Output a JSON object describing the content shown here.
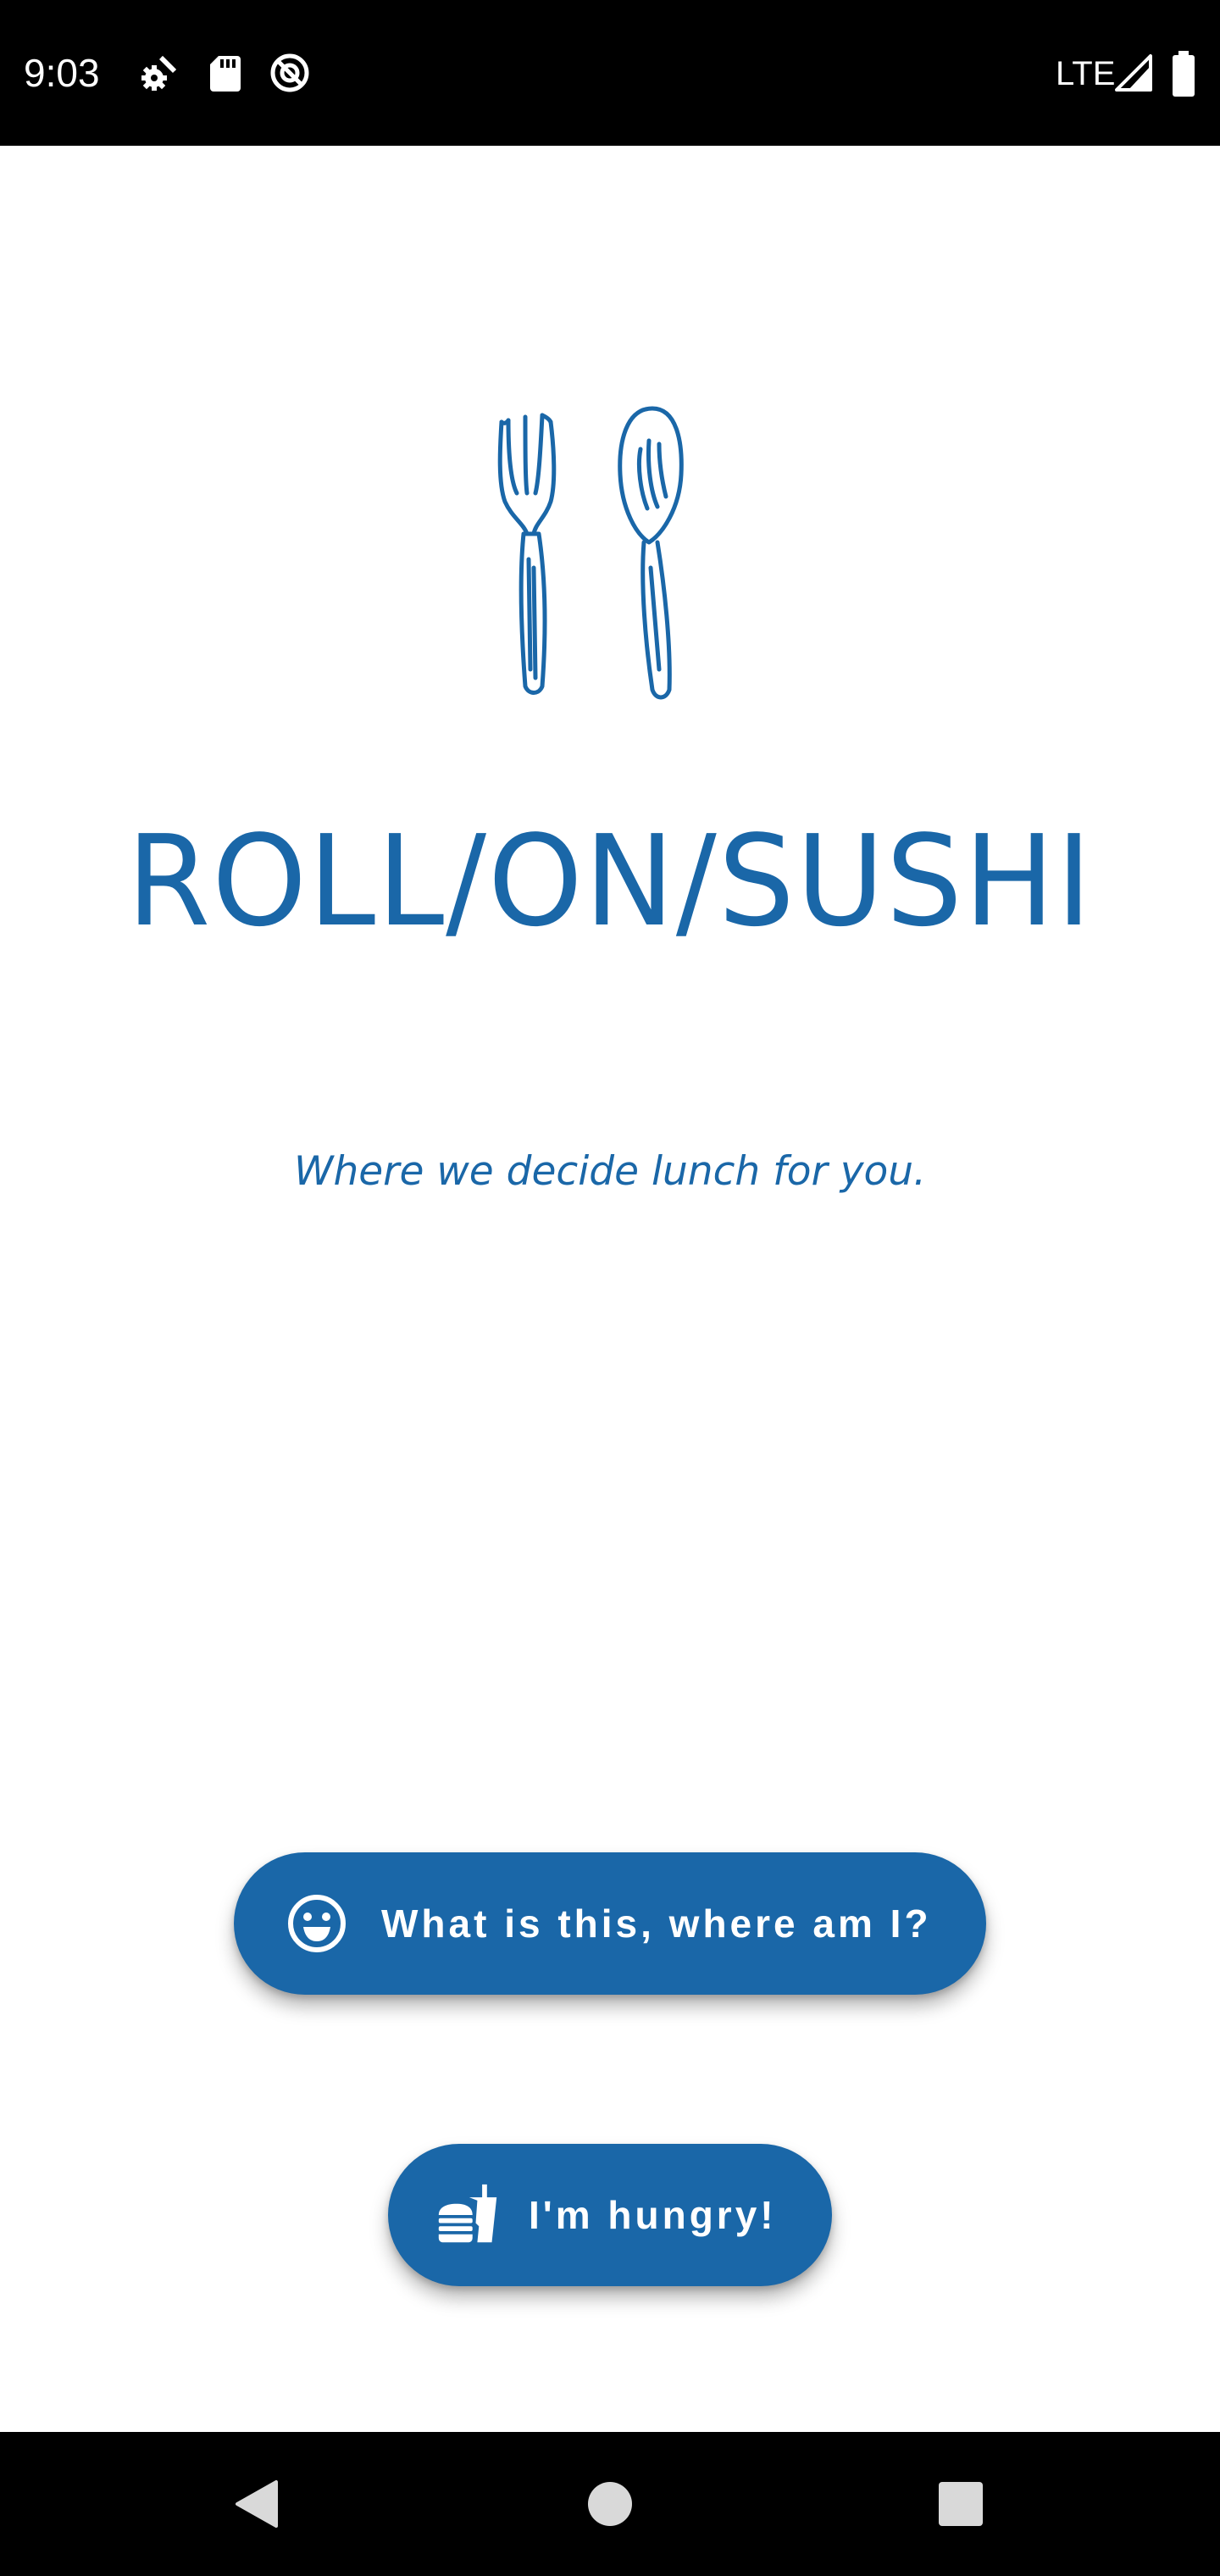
{
  "status_bar": {
    "time": "9:03",
    "network": "LTE",
    "icons": [
      "settings-gear-icon",
      "sd-card-icon",
      "no-tracking-icon",
      "signal-icon",
      "battery-icon"
    ]
  },
  "logo": {
    "icon": "fork-spoon-icon",
    "title": "ROLL/ON/SUSHI"
  },
  "tagline": "Where we decide lunch for you.",
  "buttons": {
    "info": {
      "label": "What is this, where am I?",
      "icon": "smiley-face-icon"
    },
    "hungry": {
      "label": "I'm hungry!",
      "icon": "fast-food-icon"
    }
  },
  "nav_bar": {
    "icons": [
      "back-icon",
      "home-icon",
      "recents-icon"
    ]
  },
  "colors": {
    "brand": "#1a67a8",
    "background": "#ffffff",
    "system_bars": "#000000",
    "on_brand": "#ffffff"
  }
}
